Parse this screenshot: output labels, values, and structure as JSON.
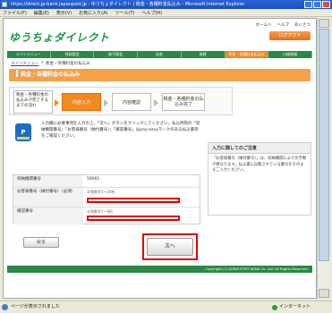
{
  "window": {
    "title": "https://direct.jp-bank.japanpost.jp - ゆうちょダイレクト | 税金・各種料金払込み - Microsoft Internet Explorer",
    "menu": [
      "ファイル(F)",
      "編集(E)",
      "表示(V)",
      "お気に入り(A)",
      "ツール(T)",
      "ヘルプ(H)"
    ]
  },
  "header": {
    "logo": "ゆうちょダイレクト",
    "links": [
      "ホームへ",
      "ヘルプ",
      "あいさつ"
    ],
    "logout": "ログアウト"
  },
  "gnav": [
    "メインメニュー",
    "残高照会",
    "取引照会",
    "送金",
    "振替",
    "税金・各種料金払込み",
    "口座情報"
  ],
  "breadcrumb": {
    "home": "メインメニュー",
    "sep": ">",
    "current": "税金・各種料金の払込み"
  },
  "banner": "税金・各種料金の払込み",
  "steps": {
    "intro": "税金・各種料金の払込みが完了するまでの流れ",
    "step1": "内容入力",
    "step2": "内容確認",
    "step3": "税金・各種料金の払込み完了"
  },
  "intro_text": "入力欄に必要事項を入力の上、「次へ」ボタンをクリックしてください。払込時刻の「収納機関番号」「お客様番号（納付番号）」「確認番号」はpay-easyマークのある払込書等をご確認ください。",
  "caution": {
    "title": "入力に関してのご注意",
    "body": "「お客様番号（納付番号）」は、収納機関により文字数が異なります。払込書に記載されている番号をそのままご入力ください。"
  },
  "form": {
    "row1": {
      "label": "収納機関番号",
      "value": "59091"
    },
    "row2": {
      "label": "お客様番号（納付番号）（必須）",
      "hint": "半角数字1～20桁"
    },
    "row3": {
      "label": "確認番号",
      "hint": "半角数字1～6桁"
    }
  },
  "buttons": {
    "back": "戻る",
    "next": "次へ"
  },
  "footer": "Copyright (C) JAPAN POST BANK Co.,Ltd. All Rights Reserved.",
  "status": {
    "text": "ページが表示されました",
    "zone": "インターネット"
  },
  "colors": {
    "accent": "#f28a1e",
    "brand": "#2a8a45",
    "highlight": "#e00000"
  }
}
